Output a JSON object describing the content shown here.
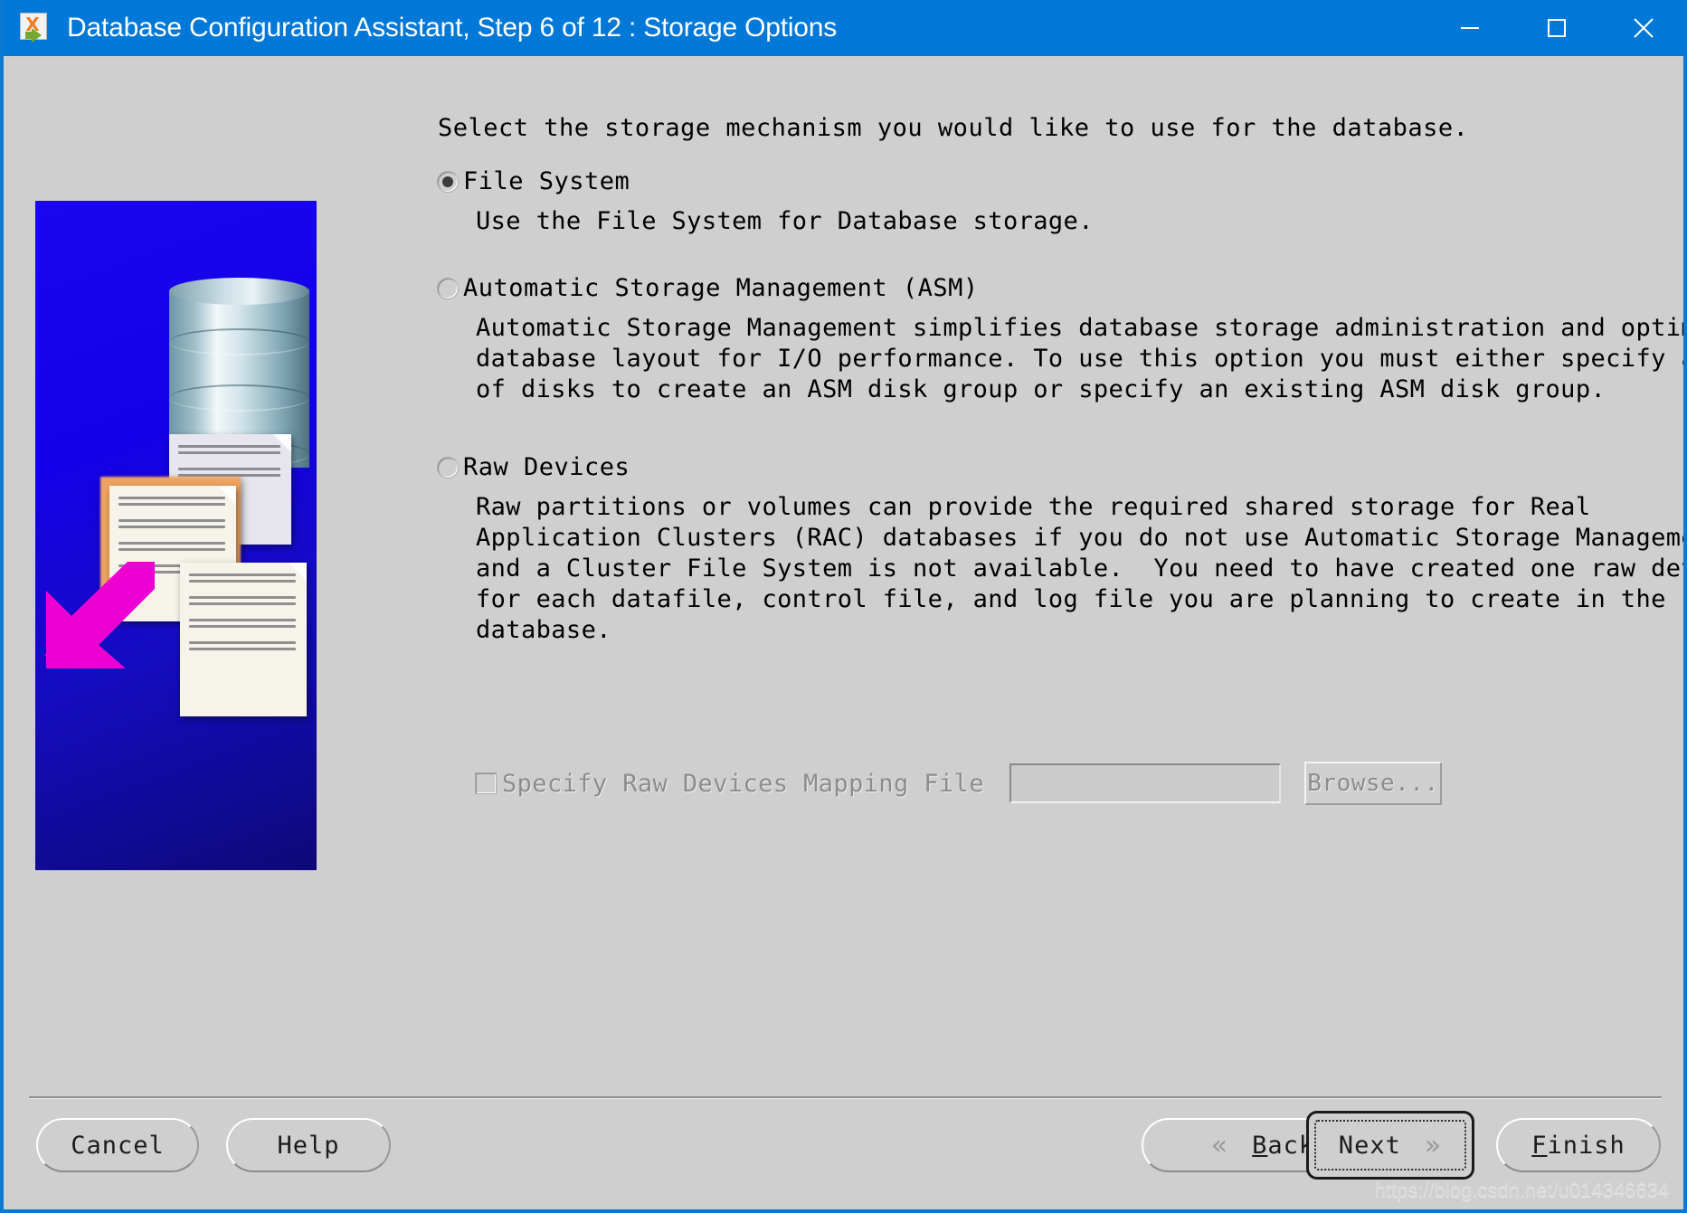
{
  "window": {
    "title": "Database Configuration Assistant, Step 6 of 12 : Storage Options",
    "app_icon": "oracle-dbca-icon",
    "controls": {
      "minimize": "minimize-icon",
      "maximize": "maximize-icon",
      "close": "close-icon"
    },
    "titlebar_color": "#0078d7",
    "body_color": "#cfcfcf"
  },
  "illustration": {
    "alt": "database-cylinder-with-documents-and-magenta-arrow",
    "background_color": "#1400e8",
    "arrow_color": "#ef00d2"
  },
  "main": {
    "intro": "Select the storage mechanism you would like to use for the database.",
    "options": [
      {
        "id": "file-system",
        "label": "File System",
        "selected": true,
        "description": "Use the File System for Database storage."
      },
      {
        "id": "asm",
        "label": "Automatic Storage Management (ASM)",
        "selected": false,
        "description": "Automatic Storage Management simplifies database storage administration and optimizes\ndatabase layout for I/O performance. To use this option you must either specify a set\nof disks to create an ASM disk group or specify an existing ASM disk group."
      },
      {
        "id": "raw-devices",
        "label": "Raw Devices",
        "selected": false,
        "description": "Raw partitions or volumes can provide the required shared storage for Real\nApplication Clusters (RAC) databases if you do not use Automatic Storage Management\nand a Cluster File System is not available.  You need to have created one raw device\nfor each datafile, control file, and log file you are planning to create in the\ndatabase."
      }
    ],
    "mapping": {
      "checkbox_label": "Specify Raw Devices Mapping File",
      "checked": false,
      "disabled": true,
      "field_value": "",
      "browse_label": "Browse..."
    }
  },
  "buttons": {
    "cancel": "Cancel",
    "help": "Help",
    "back": "Back",
    "back_mnemonic": "B",
    "next": "Next",
    "next_mnemonic": "N",
    "finish": "Finish",
    "finish_mnemonic": "F",
    "back_icon": "chevron-left-double-icon",
    "next_icon": "chevron-right-double-icon",
    "focused": "next"
  },
  "watermark": "https://blog.csdn.net/u014346634"
}
